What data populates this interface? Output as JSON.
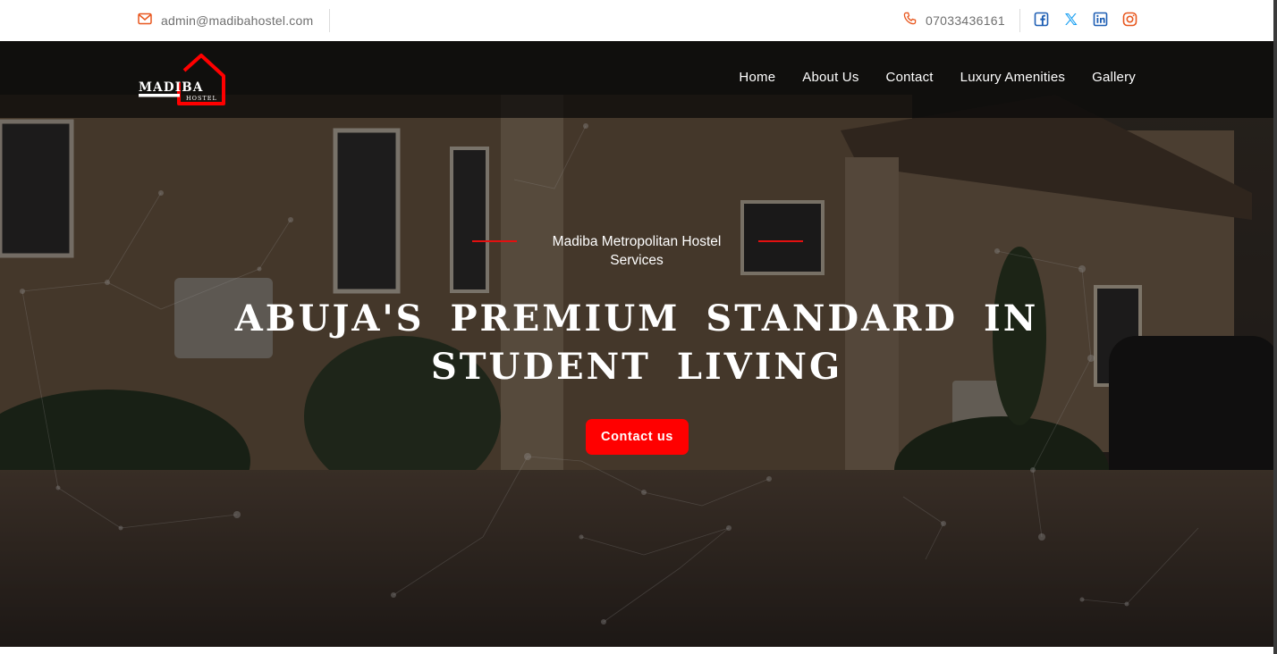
{
  "topbar": {
    "email": "admin@madibahostel.com",
    "phone": "07033436161",
    "socials": [
      "facebook-icon",
      "x-twitter-icon",
      "linkedin-icon",
      "instagram-icon"
    ]
  },
  "logo": {
    "word": "MADIBA",
    "sub": "HOSTEL"
  },
  "nav": {
    "items": [
      "Home",
      "About Us",
      "Contact",
      "Luxury Amenities",
      "Gallery"
    ]
  },
  "hero": {
    "eyebrow": "Madiba Metropolitan Hostel Services",
    "headline": "ABUJA'S PREMIUM STANDARD IN STUDENT LIVING",
    "cta": "Contact us"
  },
  "colors": {
    "accent": "#ff0000",
    "topbar_icon": "#e8571e",
    "social_blue": "#1f5fb4",
    "social_x": "#1da1f2",
    "social_instagram": "#e8571e",
    "nav_bg": "rgba(8,8,8,0.72)"
  }
}
